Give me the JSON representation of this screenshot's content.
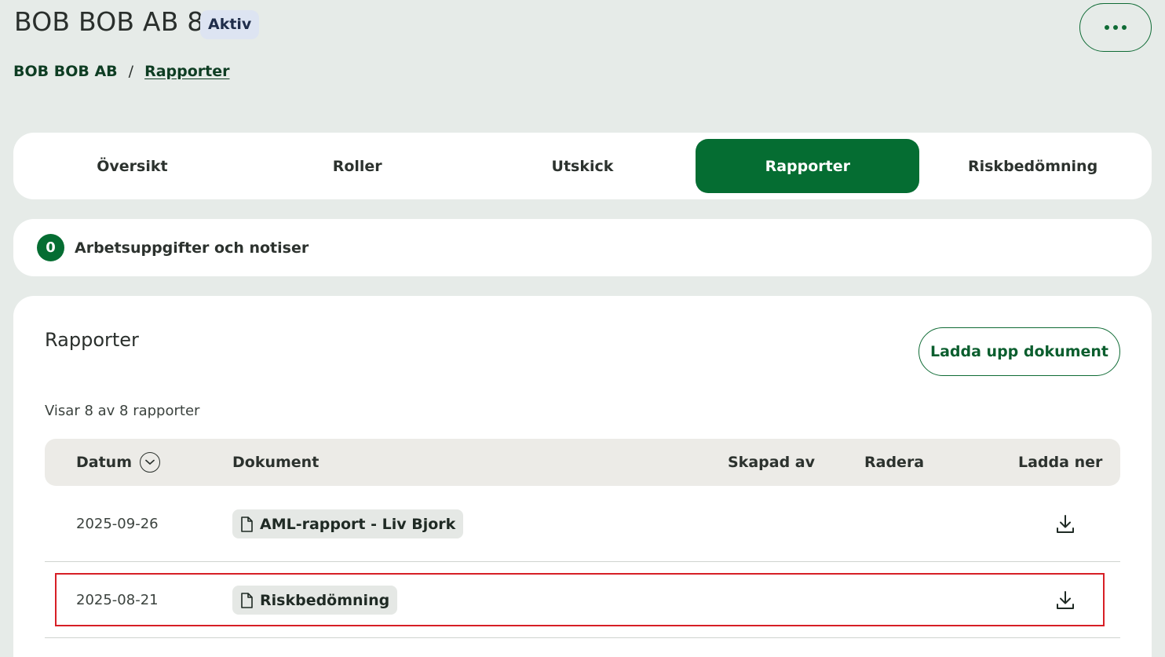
{
  "header": {
    "title": "BOB BOB AB 8",
    "status": "Aktiv",
    "more_label": "..."
  },
  "breadcrumb": {
    "parent": "BOB BOB AB",
    "separator": "/",
    "current": "Rapporter"
  },
  "tabs": [
    {
      "label": "Översikt",
      "active": false
    },
    {
      "label": "Roller",
      "active": false
    },
    {
      "label": "Utskick",
      "active": false
    },
    {
      "label": "Rapporter",
      "active": true
    },
    {
      "label": "Riskbedömning",
      "active": false
    }
  ],
  "tasks": {
    "count": "0",
    "label": "Arbetsuppgifter och notiser"
  },
  "reports": {
    "title": "Rapporter",
    "upload_label": "Ladda upp dokument",
    "count_text": "Visar 8 av 8 rapporter",
    "columns": {
      "date": "Datum",
      "document": "Dokument",
      "created_by": "Skapad av",
      "delete": "Radera",
      "download": "Ladda ner"
    },
    "rows": [
      {
        "date": "2025-09-26",
        "document": "AML-rapport - Liv Bjork",
        "created_by": ""
      },
      {
        "date": "2025-08-21",
        "document": "Riskbedömning",
        "created_by": ""
      }
    ]
  },
  "colors": {
    "accent": "#056d32",
    "highlight": "#d71f26",
    "background": "#e6ebe8"
  },
  "icons": {
    "more": "more-dots-icon",
    "sort": "chevron-down-circle-icon",
    "file": "file-icon",
    "download": "download-icon"
  }
}
